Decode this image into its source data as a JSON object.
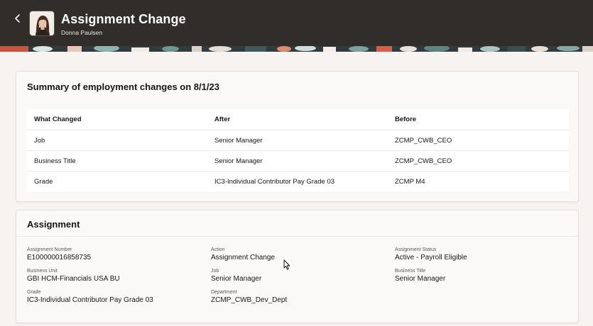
{
  "header": {
    "title": "Assignment Change",
    "subtitle": "Donna Paulsen"
  },
  "summary": {
    "title": "Summary of employment changes on 8/1/23",
    "columns": [
      "What Changed",
      "After",
      "Before"
    ],
    "rows": [
      [
        "Job",
        "Senior Manager",
        "ZCMP_CWB_CEO"
      ],
      [
        "Business Title",
        "Senior Manager",
        "ZCMP_CWB_CEO"
      ],
      [
        "Grade",
        "IC3-Individual Contributor Pay Grade 03",
        "ZCMP M4"
      ]
    ]
  },
  "assignment": {
    "title": "Assignment",
    "fields": [
      {
        "label": "Assignment Number",
        "value": "E100000016858735"
      },
      {
        "label": "Action",
        "value": "Assignment Change"
      },
      {
        "label": "Assignment Status",
        "value": "Active - Payroll Eligible"
      },
      {
        "label": "Business Unit",
        "value": "GBI HCM-Financials USA BU"
      },
      {
        "label": "Job",
        "value": "Senior Manager"
      },
      {
        "label": "Business Title",
        "value": "Senior Manager"
      },
      {
        "label": "Grade",
        "value": "IC3-Individual Contributor Pay Grade 03"
      },
      {
        "label": "Department",
        "value": "ZCMP_CWB_Dev_Dept"
      }
    ]
  },
  "icons": {
    "back": "chevron-left-icon",
    "cursor": "mouse-pointer-icon"
  },
  "colors": {
    "header_bg": "#312d2a",
    "page_bg": "#f6f3f0",
    "card_bg": "#fbf9f8"
  }
}
